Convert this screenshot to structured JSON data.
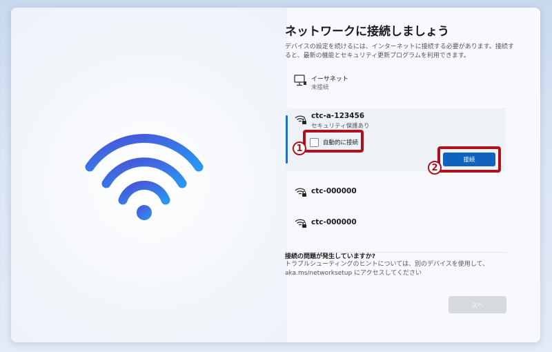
{
  "page": {
    "title": "ネットワークに接続しましょう",
    "description": "デバイスの設定を続けるには、インターネットに接続する必要があります。接続すると、最新の機能とセキュリティ更新プログラムを利用できます。"
  },
  "ethernet": {
    "icon": "monitor-ethernet-icon",
    "name": "イーサネット",
    "status": "未接続"
  },
  "networks": [
    {
      "ssid": "ctc-a-123456",
      "security": "セキュリティ保護あり",
      "icon": "wifi-lock-icon",
      "selected": true
    },
    {
      "ssid": "ctc-000000",
      "icon": "wifi-lock-icon"
    },
    {
      "ssid": "ctc-000000",
      "icon": "wifi-lock-icon"
    }
  ],
  "selected_network": {
    "auto_connect_label": "自動的に接続",
    "auto_connect_checked": false,
    "connect_label": "接続"
  },
  "annotations": {
    "marker1": "1",
    "marker2": "2",
    "color": "#b0101c"
  },
  "help": {
    "title": "接続の問題が発生していますか?",
    "text": "トラブルシューティングのヒントについては、別のデバイスを使用して、aka.ms/networksetup にアクセスしてください"
  },
  "footer": {
    "next_label": "次へ",
    "next_enabled": false
  },
  "colors": {
    "accent": "#0f62c0",
    "wifi_gradient_start": "#3f58d9",
    "wifi_gradient_end": "#2f8ef0"
  }
}
